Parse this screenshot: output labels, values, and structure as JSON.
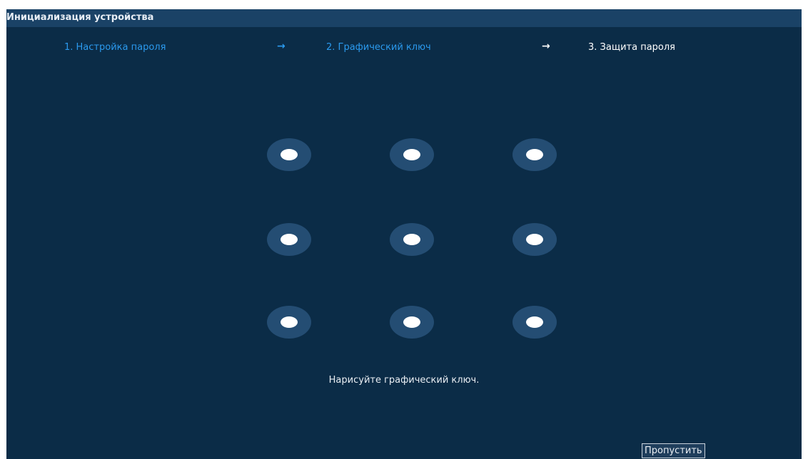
{
  "window": {
    "title": "Инициализация устройства"
  },
  "steps": [
    {
      "label": "1.  Настройка пароля",
      "state": "done"
    },
    {
      "label": "2.  Графический ключ",
      "state": "done"
    },
    {
      "label": "3.  Защита пароля",
      "state": "current"
    }
  ],
  "arrows": [
    "→",
    "→"
  ],
  "pattern": {
    "rows": 3,
    "cols": 3,
    "hint": "Нарисуйте графический ключ."
  },
  "footer": {
    "skip_label": "Пропустить"
  },
  "colors": {
    "background": "#0b2c47",
    "titlebar": "#1a4266",
    "accent": "#2b9aee",
    "node_ring": "#244d73",
    "node_dot": "#ffffff"
  }
}
